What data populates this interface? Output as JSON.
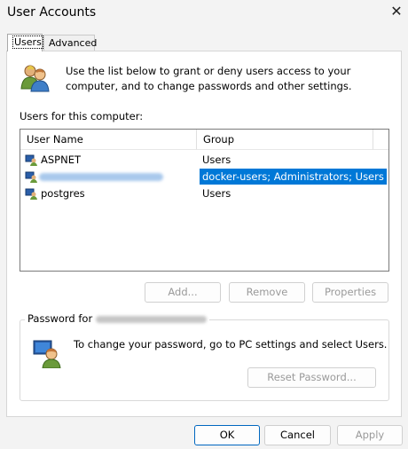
{
  "window": {
    "title": "User Accounts",
    "close_glyph": "✕"
  },
  "tabs": [
    {
      "label": "Users"
    },
    {
      "label": "Advanced"
    }
  ],
  "intro_text": "Use the list below to grant or deny users access to your computer, and to change passwords and other settings.",
  "users_label": "Users for this computer:",
  "table": {
    "columns": [
      "User Name",
      "Group"
    ],
    "rows": [
      {
        "name": "ASPNET",
        "group": "Users",
        "selected": false
      },
      {
        "name": "",
        "group": "docker-users; Administrators; Users",
        "selected": true
      },
      {
        "name": "postgres",
        "group": "Users",
        "selected": false
      }
    ]
  },
  "buttons": {
    "add": "Add...",
    "remove": "Remove",
    "properties": "Properties",
    "reset_password": "Reset Password...",
    "ok": "OK",
    "cancel": "Cancel",
    "apply": "Apply"
  },
  "password_group": {
    "label": "Password for",
    "text": "To change your password, go to PC settings and select Users."
  },
  "icons": [
    "users-icon",
    "user-computer-icon",
    "user-key-icon"
  ],
  "colors": {
    "selection": "#0078d7",
    "primary_border": "#0067c0"
  }
}
